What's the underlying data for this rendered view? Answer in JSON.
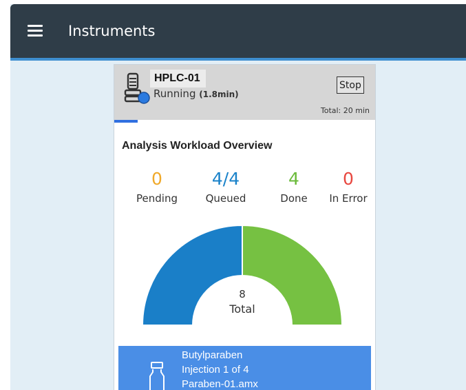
{
  "header": {
    "menu_icon": "hamburger-icon",
    "title": "Instruments"
  },
  "instrument": {
    "icon": "hplc-instrument-icon",
    "name": "HPLC-01",
    "status": "Running",
    "elapsed": "(1.8min)",
    "stop_label": "Stop",
    "total_time": "Total: 20 min",
    "progress_fraction": 0.09
  },
  "overview": {
    "title": "Analysis Workload Overview",
    "stats": [
      {
        "value": "0",
        "label": "Pending",
        "color": "#f0a92a"
      },
      {
        "value": "4/4",
        "label": "Queued",
        "color": "#1a82c9"
      },
      {
        "value": "4",
        "label": "Done",
        "color": "#6aba3a"
      },
      {
        "value": "0",
        "label": "In Error",
        "color": "#e8473f"
      }
    ],
    "donut": {
      "total_value": "8",
      "total_label": "Total",
      "segments": [
        {
          "name": "Queued",
          "value": 4,
          "color": "#1a7fc8"
        },
        {
          "name": "Done",
          "value": 4,
          "color": "#76c142"
        }
      ]
    }
  },
  "queue_item": {
    "icon": "vial-icon",
    "compound": "Butylparaben",
    "injection": "Injection 1 of 4",
    "method": "Paraben-01.amx"
  }
}
